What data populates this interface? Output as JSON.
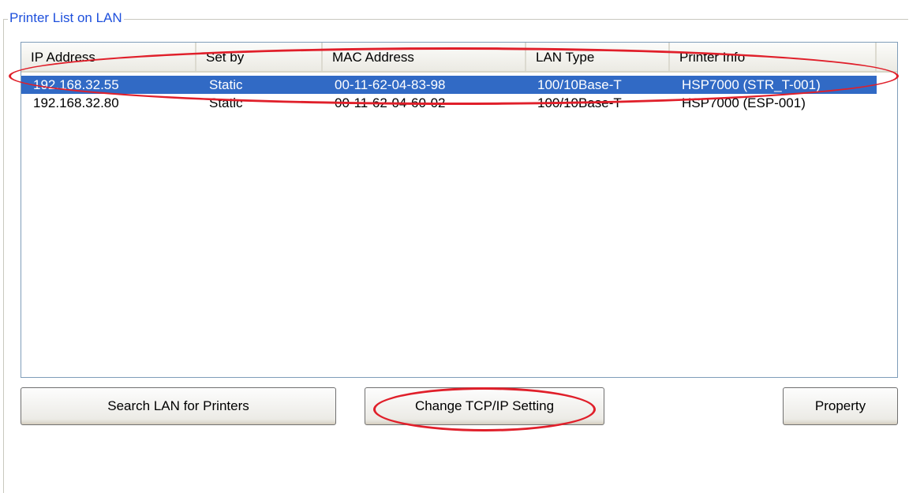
{
  "group": {
    "title": "Printer List on LAN"
  },
  "columns": [
    "IP Address",
    "Set by",
    "MAC Address",
    "LAN Type",
    "Printer Info"
  ],
  "rows": [
    {
      "ip": "192.168.32.55",
      "set_by": "Static",
      "mac": "00-11-62-04-83-98",
      "lan_type": "100/10Base-T",
      "info": "HSP7000 (STR_T-001)",
      "selected": true
    },
    {
      "ip": "192.168.32.80",
      "set_by": "Static",
      "mac": "00-11-62-04-60-02",
      "lan_type": "100/10Base-T",
      "info": "HSP7000 (ESP-001)",
      "selected": false
    }
  ],
  "buttons": {
    "search": "Search LAN for Printers",
    "change_tcpip": "Change TCP/IP Setting",
    "property": "Property"
  },
  "colors": {
    "selection": "#316ac5",
    "annotation": "#e01f2a",
    "group_title": "#1e50dc"
  }
}
